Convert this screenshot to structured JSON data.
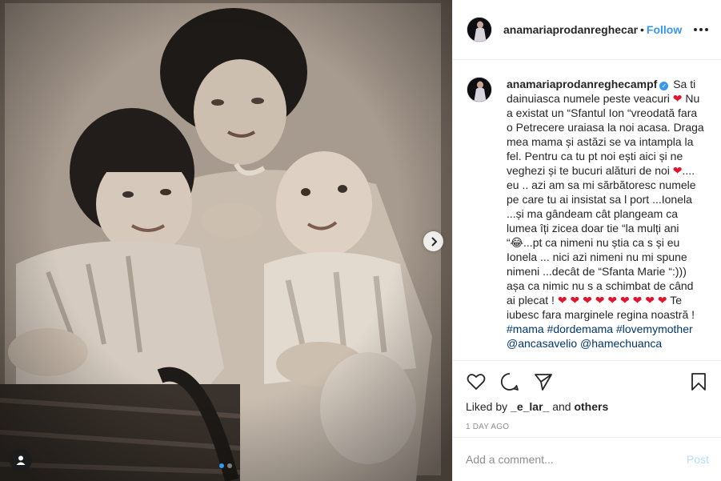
{
  "post": {
    "username": "anamariaprodanreghecampf",
    "header_username": "anamariaprodanreghecam",
    "separator": "•",
    "follow_label": "Follow",
    "verified_glyph": "✓",
    "caption_parts": {
      "p1": "Sa ti dainuiasca numele peste veacuri ",
      "p2": " Nu a existat un “Sfantul Ion “vreodată fara o Petrecere uraiasa la noi acasa. Draga mea mama și astăzi se va intampla la fel. Pentru ca tu pt noi ești aici și ne veghezi și te bucuri alături de noi ",
      "p3": ".... eu .. azi am sa mi sărbătoresc numele pe care tu ai insistat sa l port ...Ionela ...și ma gândeam cât plangeam ca lumea îți zicea doar tie “la mulți ani “",
      "p4": "...pt ca nimeni nu știa ca s și eu Ionela ... nici azi nimeni nu mi spune nimeni ...decât de “Sfanta Marie “:))) așa ca nimic nu s a schimbat de când ai plecat ! ",
      "p5": " Te iubesc fara marginele regina noastră ! ",
      "tags_line": "#mama #dordemama",
      "tags_line2": "#lovemymother",
      "mention": "@ancasavelio",
      "mention2": "@hamechuanca"
    },
    "heart_glyph": "❤",
    "laugh_emoji": "😂",
    "likes_prefix": "Liked by",
    "likes_user": "_e_lar_",
    "likes_and": "and",
    "likes_others": "others",
    "time_ago": "1 DAY AGO",
    "comment_placeholder": "Add a comment...",
    "post_label": "Post"
  },
  "icons": {
    "like": "heart-outline-icon",
    "comment": "comment-bubble-icon",
    "share": "paper-plane-icon",
    "save": "bookmark-icon",
    "more": "more-options-icon",
    "next": "chevron-right-icon",
    "tag": "user-tag-icon"
  },
  "carousel": {
    "current": 1,
    "total": 2
  },
  "colors": {
    "link": "#3897f0",
    "heart": "#e0142e",
    "muted": "#8e8e8e",
    "post_disabled": "#b2dffc"
  }
}
